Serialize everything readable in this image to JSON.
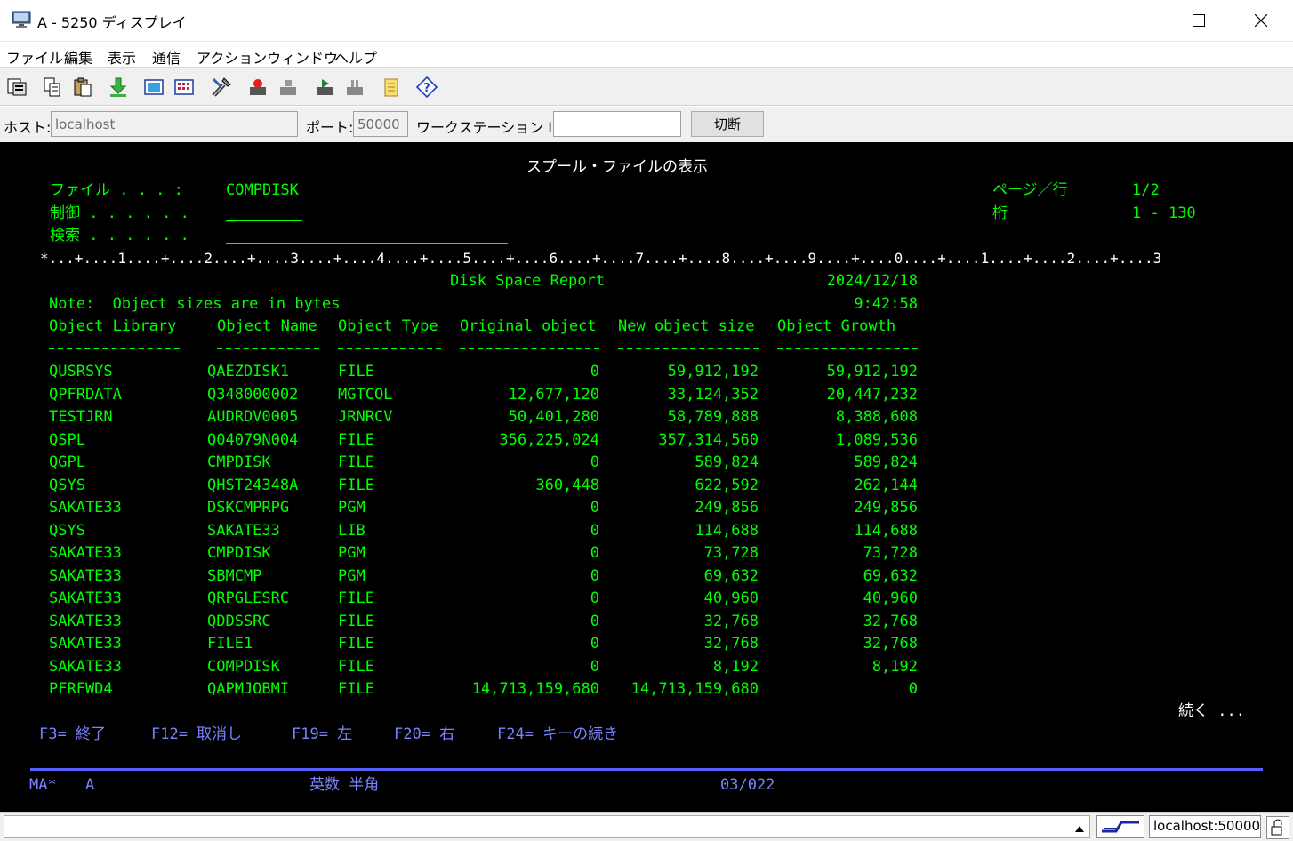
{
  "window": {
    "title": "A - 5250 ディスプレイ",
    "minimize": "—",
    "maximize": "☐",
    "close": "✕"
  },
  "menu": [
    "ファイル",
    "編集",
    "表示",
    "通信",
    "アクション",
    "ウィンドウ",
    "ヘルプ"
  ],
  "toolbar_icons": [
    "copy-screen-icon",
    "copy-icon",
    "paste-icon",
    "receive-file-icon",
    "macro-icon",
    "keypad-icon",
    "tools-icon",
    "record-macro-icon",
    "stop-macro-icon",
    "play-macro-icon",
    "pause-macro-icon",
    "notepad-icon",
    "help-icon"
  ],
  "connection": {
    "host_label": "ホスト:",
    "host_value": "localhost",
    "port_label": "ポート:",
    "port_value": "50000",
    "ws_label": "ワークステーション ID:",
    "ws_value": "",
    "disconnect_label": "切断"
  },
  "screen": {
    "title": "スプール・ファイルの表示",
    "file_label": "ファイル . . . :",
    "file_value": "COMPDISK",
    "control_label": "制御 . . . . . .",
    "control_value": "_",
    "search_label": "検索 . . . . . .",
    "page_label": "ページ／行",
    "page_value": "1/2",
    "column_label": "桁",
    "column_value": "1 - 130",
    "ruler": "*...+....1....+....2....+....3....+....4....+....5....+....6....+....7....+....8....+....9....+....0....+....1....+....2....+....3",
    "report_title": "Disk Space Report",
    "report_date": "2024/12/18",
    "report_time": "9:42:58",
    "note": "Note:  Object sizes are in bytes",
    "headers": [
      "Object Library",
      "Object Name",
      "Object Type",
      "Original object",
      "New object size",
      "Object Growth"
    ],
    "rows": [
      [
        "QUSRSYS",
        "QAEZDISK1",
        "FILE",
        "0",
        "59,912,192",
        "59,912,192"
      ],
      [
        "QPFRDATA",
        "Q348000002",
        "MGTCOL",
        "12,677,120",
        "33,124,352",
        "20,447,232"
      ],
      [
        "TESTJRN",
        "AUDRDV0005",
        "JRNRCV",
        "50,401,280",
        "58,789,888",
        "8,388,608"
      ],
      [
        "QSPL",
        "Q04079N004",
        "FILE",
        "356,225,024",
        "357,314,560",
        "1,089,536"
      ],
      [
        "QGPL",
        "CMPDISK",
        "FILE",
        "0",
        "589,824",
        "589,824"
      ],
      [
        "QSYS",
        "QHST24348A",
        "FILE",
        "360,448",
        "622,592",
        "262,144"
      ],
      [
        "SAKATE33",
        "DSKCMPRPG",
        "PGM",
        "0",
        "249,856",
        "249,856"
      ],
      [
        "QSYS",
        "SAKATE33",
        "LIB",
        "0",
        "114,688",
        "114,688"
      ],
      [
        "SAKATE33",
        "CMPDISK",
        "PGM",
        "0",
        "73,728",
        "73,728"
      ],
      [
        "SAKATE33",
        "SBMCMP",
        "PGM",
        "0",
        "69,632",
        "69,632"
      ],
      [
        "SAKATE33",
        "QRPGLESRC",
        "FILE",
        "0",
        "40,960",
        "40,960"
      ],
      [
        "SAKATE33",
        "QDDSSRC",
        "FILE",
        "0",
        "32,768",
        "32,768"
      ],
      [
        "SAKATE33",
        "FILE1",
        "FILE",
        "0",
        "32,768",
        "32,768"
      ],
      [
        "SAKATE33",
        "COMPDISK",
        "FILE",
        "0",
        "8,192",
        "8,192"
      ],
      [
        "PFRFWD4",
        "QAPMJOBMI",
        "FILE",
        "14,713,159,680",
        "14,713,159,680",
        "0"
      ]
    ],
    "more": "続く ...",
    "fkeys": [
      "F3= 終了",
      "F12= 取消し",
      "F19= 左",
      "F20= 右",
      "F24= キーの続き"
    ],
    "oia_left": "MA*",
    "oia_session": "A",
    "oia_input": "英数 半角",
    "oia_cursor": "03/022"
  },
  "status": {
    "host_port": "localhost:50000"
  }
}
